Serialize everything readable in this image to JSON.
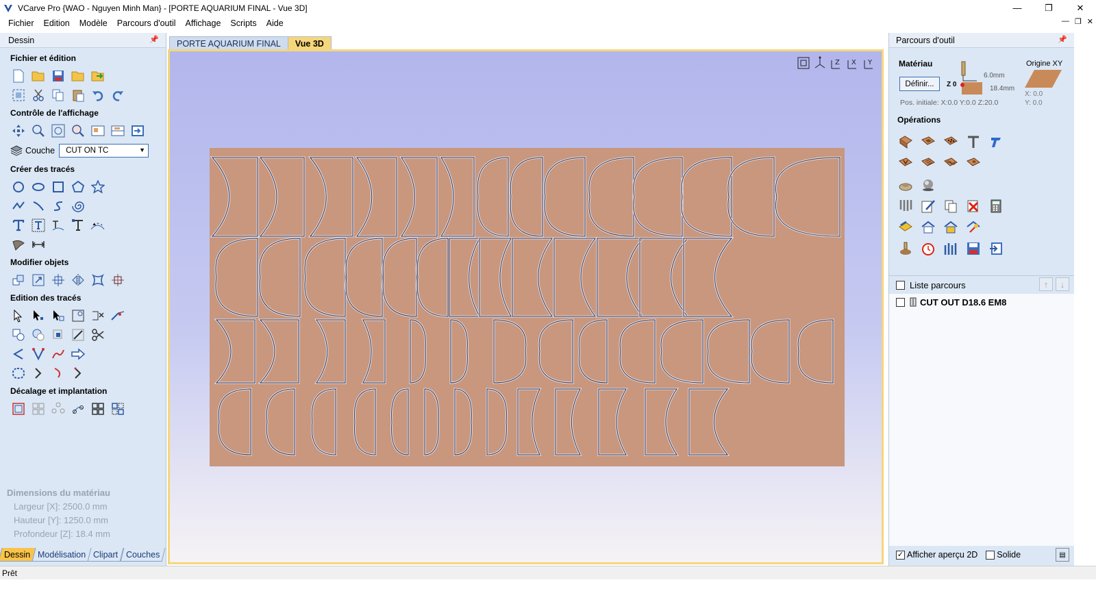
{
  "window": {
    "title": "VCarve Pro {WAO - Nguyen Minh Man} - [PORTE AQUARIUM FINAL - Vue 3D]",
    "minimize": "—",
    "maximize": "❐",
    "close": "✕"
  },
  "menu": [
    "Fichier",
    "Edition",
    "Modèle",
    "Parcours d'outil",
    "Affichage",
    "Scripts",
    "Aide"
  ],
  "mdi_controls": [
    "—",
    "❐",
    "✕"
  ],
  "left_panel": {
    "header": "Dessin",
    "sections": {
      "file_edit": "Fichier et édition",
      "view_control": "Contrôle de l'affichage",
      "create": "Créer des tracés",
      "modify": "Modifier objets",
      "edit": "Edition des tracés",
      "offset": "Décalage et implantation"
    },
    "layer_label": "Couche",
    "layer_value": "CUT ON TC",
    "dims": {
      "title": "Dimensions du matériau",
      "width": "Largeur     [X]: 2500.0 mm",
      "height": "Hauteur     [Y]: 1250.0 mm",
      "depth": "Profondeur [Z]: 18.4 mm"
    },
    "tabs": [
      "Dessin",
      "Modélisation",
      "Clipart",
      "Couches"
    ]
  },
  "doc_tabs": [
    "PORTE AQUARIUM FINAL",
    "Vue 3D"
  ],
  "right_panel": {
    "header": "Parcours d'outil",
    "material_title": "Matériau",
    "define_button": "Définir...",
    "z0": "Z 0",
    "thickness_top": "6.0mm",
    "thickness_bottom": "18.4mm",
    "origin_label": "Origine XY",
    "origin_x": "X: 0.0",
    "origin_y": "Y: 0.0",
    "initial_pos": "Pos. initiale: X:0.0 Y:0.0 Z:20.0",
    "operations_title": "Opérations",
    "list_header": "Liste parcours",
    "toolpaths": [
      "CUT OUT D18.6 EM8"
    ],
    "footer_preview": "Afficher aperçu 2D",
    "footer_solid": "Solide"
  },
  "status": "Prêt",
  "colors": {
    "panel": "#dbe7f5",
    "board": "#c8977e",
    "active_tab": "#f6d67a",
    "view_top": "#b2b6ec"
  }
}
